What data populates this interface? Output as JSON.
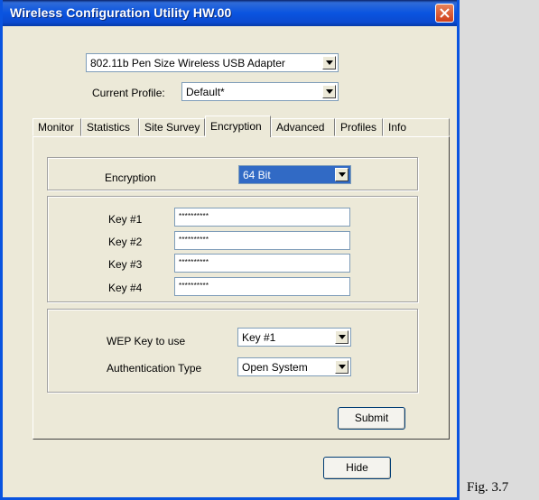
{
  "window": {
    "title": "Wireless Configuration Utility HW.00"
  },
  "adapter": {
    "selected": "802.11b Pen Size Wireless USB Adapter"
  },
  "profile": {
    "label": "Current Profile:",
    "selected": "Default*"
  },
  "tabs": [
    {
      "label": "Monitor"
    },
    {
      "label": "Statistics"
    },
    {
      "label": "Site Survey"
    },
    {
      "label": "Encryption"
    },
    {
      "label": "Advanced"
    },
    {
      "label": "Profiles"
    },
    {
      "label": "Info"
    }
  ],
  "encryption": {
    "label": "Encryption",
    "selected": "64 Bit"
  },
  "keys": [
    {
      "label": "Key #1",
      "value": "**********"
    },
    {
      "label": "Key #2",
      "value": "**********"
    },
    {
      "label": "Key #3",
      "value": "**********"
    },
    {
      "label": "Key #4",
      "value": "**********"
    }
  ],
  "wep": {
    "label": "WEP Key to use",
    "selected": "Key #1"
  },
  "auth": {
    "label": "Authentication Type",
    "selected": "Open System"
  },
  "buttons": {
    "submit": "Submit",
    "hide": "Hide"
  },
  "caption": "Fig. 3.7"
}
